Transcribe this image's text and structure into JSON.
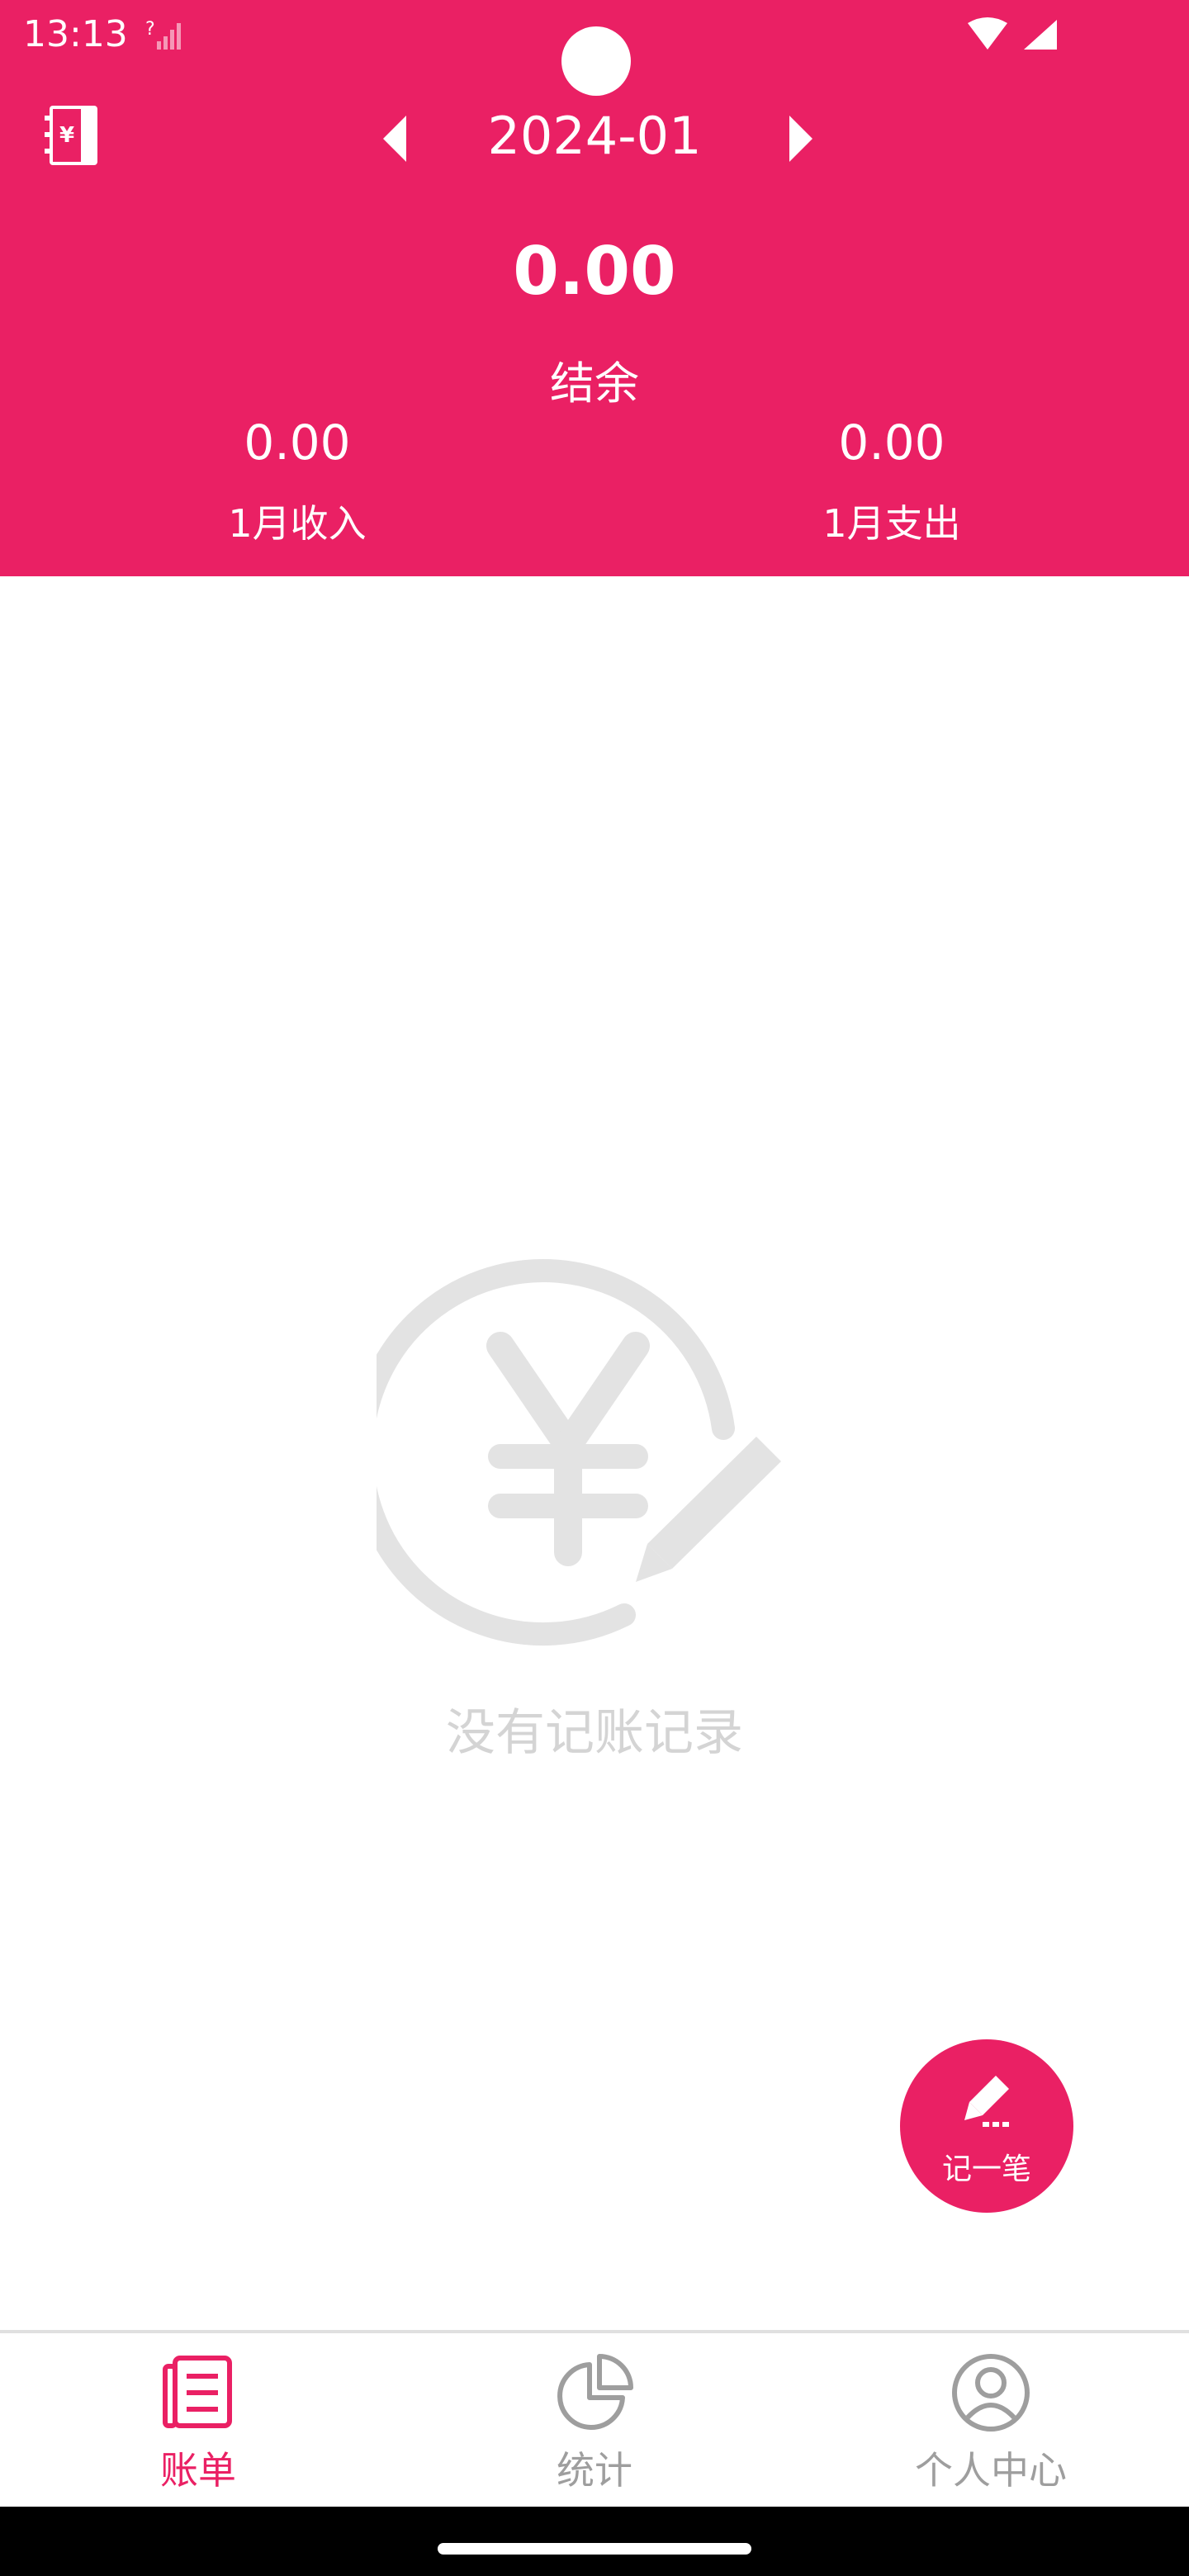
{
  "status_bar": {
    "time": "13:13"
  },
  "header": {
    "month": "2024-01",
    "balance": "0.00",
    "balance_label": "结余",
    "income_value": "0.00",
    "income_label": "1月收入",
    "expense_value": "0.00",
    "expense_label": "1月支出"
  },
  "empty_state": {
    "text": "没有记账记录"
  },
  "fab": {
    "label": "记一笔"
  },
  "bottom_nav": {
    "items": [
      {
        "label": "账单",
        "icon": "bill-icon",
        "active": true
      },
      {
        "label": "统计",
        "icon": "pie-chart-icon",
        "active": false
      },
      {
        "label": "个人中心",
        "icon": "user-icon",
        "active": false
      }
    ]
  },
  "colors": {
    "accent": "#EA2064",
    "inactive": "#9e9e9e",
    "empty_gray": "#e0e0e0"
  }
}
